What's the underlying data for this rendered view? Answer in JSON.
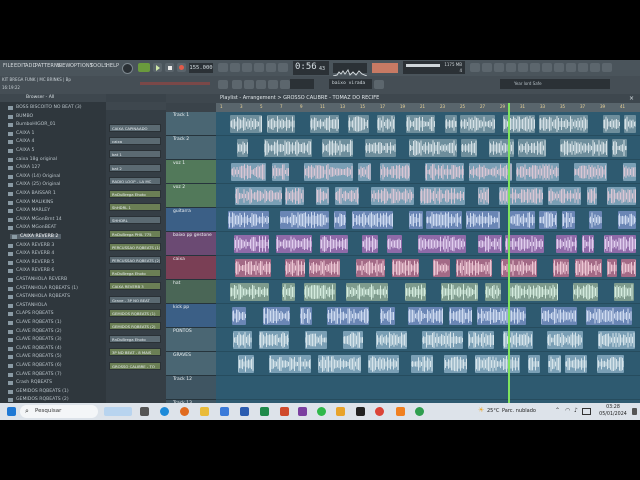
{
  "menu": [
    "FILE",
    "EDIT",
    "ADD",
    "PATTERNS",
    "VIEW",
    "OPTIONS",
    "TOOLS",
    "HELP"
  ],
  "hint": "KIT BREGA FUNK | MC BRINKS | Bp",
  "hint2": "16:19:22",
  "tempo": "155.000",
  "time": "0:56",
  "time_sub": "43",
  "cpu_label": "1175 MB",
  "cpu_val": "4",
  "pattern_name": "baixo virada",
  "news": "Year lord Safe",
  "playlist_title": "Playlist - Arrangement > GROSSO CALIBRE - TOMAZ DO RECIFE",
  "browser_head": "Browser - All",
  "browser_items": [
    "BOSS BISCOITO NO BEAT (3)",
    "BUMBO",
    "BumboHIGOR_01",
    "CAIXA 1",
    "CAIXA 4",
    "CAIXA 5",
    "caixa 18g original",
    "CAIXA 127",
    "CAIXA (14) Original",
    "CAIXA (25) Original",
    "CAIXA BAISSAR 1",
    "CAIXA MALIKINS",
    "CAIXA MARLEY",
    "CAIXA MGonBrnt 14",
    "CAIXA MGonBEAT",
    "CAIXA REVERB 2",
    "CAIXA REVERB 3",
    "CAIXA REVERB 4",
    "CAIXA REVERB 5",
    "CAIXA REVERB 6",
    "CASTANHOLA REVERB",
    "CASTANHOLA RQBEATS (1)",
    "CASTANHOLA RQBEATS",
    "CASTANHOLA",
    "CLAPS RQBEATS",
    "CLAVE RQBEATS (1)",
    "CLAVE RQBEATS (2)",
    "CLAVE RQBEATS (3)",
    "CLAVE RQBEATS (4)",
    "CLAVE RQBEATS (5)",
    "CLAVE RQBEATS (6)",
    "CLAVE RQBEATS (7)",
    "Crash RQBEATS",
    "GEMIDOS RQBEATS (1)",
    "GEMIDOS RQBEATS (2)"
  ],
  "rack_channels": [
    "CAIXA CAPINAADO",
    "caixa",
    "bat 1",
    "bat 2",
    "RADIO LOOP - LA MC",
    "RnDuBrega Ehoto",
    "ShHDRL 1",
    "SHHDRL",
    "RnDuBrega PHIL 775",
    "PERCUSSAO RQBEATS (1)",
    "PERCUSSAO RQBEATS (2)",
    "RnDuBrega Ehoto",
    "CAIXA REVERB 3",
    "Grave - 3P NO BEAT",
    "GEMIDOS RQBEATS (1)",
    "GEMIDOS RQBEATS (2)",
    "RnDuBrega Ehoto",
    "3P ND BEAT - 8 MAIS",
    "GROSSO CALIBRE - TO"
  ],
  "tracks": [
    "Track 1",
    "Track 2",
    "voz 1",
    "voz 2",
    "guitarra",
    "baixo pp gestone",
    "caixa",
    "hat",
    "kick pp",
    "PONTOS",
    "GRAVES",
    "Track 12",
    "Track 13"
  ],
  "ruler_marks": [
    "1",
    "3",
    "5",
    "7",
    "9",
    "11",
    "13",
    "15",
    "17",
    "19",
    "21",
    "23",
    "25",
    "27",
    "29",
    "31",
    "33",
    "35",
    "37",
    "39",
    "41"
  ],
  "taskbar": {
    "search": "Pesquisar",
    "weather_temp": "25°C",
    "weather_text": "Parc. nublado",
    "clock_time": "03:28",
    "clock_date": "05/01/2024"
  },
  "colors": {
    "track_label": [
      "#4a6673",
      "#4a6673",
      "#52795a",
      "#52795a",
      "#3b5f86",
      "#6b4a73",
      "#7a3f55",
      "#4a6656",
      "#3b5f86",
      "#4a6673",
      "#4a6673",
      "#3f5562",
      "#3f5562"
    ],
    "clip": [
      "#6e8e9c",
      "#6e8e9c",
      "#7a9fb5",
      "#7a9fb5",
      "#6a86b5",
      "#8f6aa8",
      "#a36a86",
      "#7e9b8d",
      "#6a86b5",
      "#7a9fb5",
      "#7a9fb5",
      "#2e5a70",
      "#2e5a70"
    ],
    "wave": [
      "#eef5f8",
      "#eef5f8",
      "#f3d0dc",
      "#f3d0dc",
      "#e8f0ff",
      "#f4e6ff",
      "#ffdfe8",
      "#e9fff2",
      "#e8f0ff",
      "#eef5f8",
      "#eef5f8",
      "#ffffff",
      "#ffffff"
    ]
  }
}
